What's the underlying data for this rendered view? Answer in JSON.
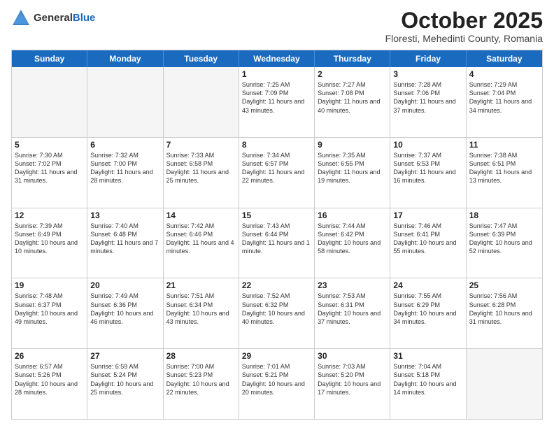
{
  "header": {
    "logo": {
      "general": "General",
      "blue": "Blue"
    },
    "month": "October 2025",
    "location": "Floresti, Mehedinti County, Romania"
  },
  "days_of_week": [
    "Sunday",
    "Monday",
    "Tuesday",
    "Wednesday",
    "Thursday",
    "Friday",
    "Saturday"
  ],
  "weeks": [
    [
      {
        "day": "",
        "empty": true
      },
      {
        "day": "",
        "empty": true
      },
      {
        "day": "",
        "empty": true
      },
      {
        "day": "1",
        "sunrise": "7:25 AM",
        "sunset": "7:09 PM",
        "daylight": "11 hours and 43 minutes."
      },
      {
        "day": "2",
        "sunrise": "7:27 AM",
        "sunset": "7:08 PM",
        "daylight": "11 hours and 40 minutes."
      },
      {
        "day": "3",
        "sunrise": "7:28 AM",
        "sunset": "7:06 PM",
        "daylight": "11 hours and 37 minutes."
      },
      {
        "day": "4",
        "sunrise": "7:29 AM",
        "sunset": "7:04 PM",
        "daylight": "11 hours and 34 minutes."
      }
    ],
    [
      {
        "day": "5",
        "sunrise": "7:30 AM",
        "sunset": "7:02 PM",
        "daylight": "11 hours and 31 minutes."
      },
      {
        "day": "6",
        "sunrise": "7:32 AM",
        "sunset": "7:00 PM",
        "daylight": "11 hours and 28 minutes."
      },
      {
        "day": "7",
        "sunrise": "7:33 AM",
        "sunset": "6:58 PM",
        "daylight": "11 hours and 25 minutes."
      },
      {
        "day": "8",
        "sunrise": "7:34 AM",
        "sunset": "6:57 PM",
        "daylight": "11 hours and 22 minutes."
      },
      {
        "day": "9",
        "sunrise": "7:35 AM",
        "sunset": "6:55 PM",
        "daylight": "11 hours and 19 minutes."
      },
      {
        "day": "10",
        "sunrise": "7:37 AM",
        "sunset": "6:53 PM",
        "daylight": "11 hours and 16 minutes."
      },
      {
        "day": "11",
        "sunrise": "7:38 AM",
        "sunset": "6:51 PM",
        "daylight": "11 hours and 13 minutes."
      }
    ],
    [
      {
        "day": "12",
        "sunrise": "7:39 AM",
        "sunset": "6:49 PM",
        "daylight": "10 hours and 10 minutes."
      },
      {
        "day": "13",
        "sunrise": "7:40 AM",
        "sunset": "6:48 PM",
        "daylight": "11 hours and 7 minutes."
      },
      {
        "day": "14",
        "sunrise": "7:42 AM",
        "sunset": "6:46 PM",
        "daylight": "11 hours and 4 minutes."
      },
      {
        "day": "15",
        "sunrise": "7:43 AM",
        "sunset": "6:44 PM",
        "daylight": "11 hours and 1 minute."
      },
      {
        "day": "16",
        "sunrise": "7:44 AM",
        "sunset": "6:42 PM",
        "daylight": "10 hours and 58 minutes."
      },
      {
        "day": "17",
        "sunrise": "7:46 AM",
        "sunset": "6:41 PM",
        "daylight": "10 hours and 55 minutes."
      },
      {
        "day": "18",
        "sunrise": "7:47 AM",
        "sunset": "6:39 PM",
        "daylight": "10 hours and 52 minutes."
      }
    ],
    [
      {
        "day": "19",
        "sunrise": "7:48 AM",
        "sunset": "6:37 PM",
        "daylight": "10 hours and 49 minutes."
      },
      {
        "day": "20",
        "sunrise": "7:49 AM",
        "sunset": "6:36 PM",
        "daylight": "10 hours and 46 minutes."
      },
      {
        "day": "21",
        "sunrise": "7:51 AM",
        "sunset": "6:34 PM",
        "daylight": "10 hours and 43 minutes."
      },
      {
        "day": "22",
        "sunrise": "7:52 AM",
        "sunset": "6:32 PM",
        "daylight": "10 hours and 40 minutes."
      },
      {
        "day": "23",
        "sunrise": "7:53 AM",
        "sunset": "6:31 PM",
        "daylight": "10 hours and 37 minutes."
      },
      {
        "day": "24",
        "sunrise": "7:55 AM",
        "sunset": "6:29 PM",
        "daylight": "10 hours and 34 minutes."
      },
      {
        "day": "25",
        "sunrise": "7:56 AM",
        "sunset": "6:28 PM",
        "daylight": "10 hours and 31 minutes."
      }
    ],
    [
      {
        "day": "26",
        "sunrise": "6:57 AM",
        "sunset": "5:26 PM",
        "daylight": "10 hours and 28 minutes."
      },
      {
        "day": "27",
        "sunrise": "6:59 AM",
        "sunset": "5:24 PM",
        "daylight": "10 hours and 25 minutes."
      },
      {
        "day": "28",
        "sunrise": "7:00 AM",
        "sunset": "5:23 PM",
        "daylight": "10 hours and 22 minutes."
      },
      {
        "day": "29",
        "sunrise": "7:01 AM",
        "sunset": "5:21 PM",
        "daylight": "10 hours and 20 minutes."
      },
      {
        "day": "30",
        "sunrise": "7:03 AM",
        "sunset": "5:20 PM",
        "daylight": "10 hours and 17 minutes."
      },
      {
        "day": "31",
        "sunrise": "7:04 AM",
        "sunset": "5:18 PM",
        "daylight": "10 hours and 14 minutes."
      },
      {
        "day": "",
        "empty": true
      }
    ]
  ],
  "labels": {
    "sunrise": "Sunrise:",
    "sunset": "Sunset:",
    "daylight": "Daylight:"
  }
}
